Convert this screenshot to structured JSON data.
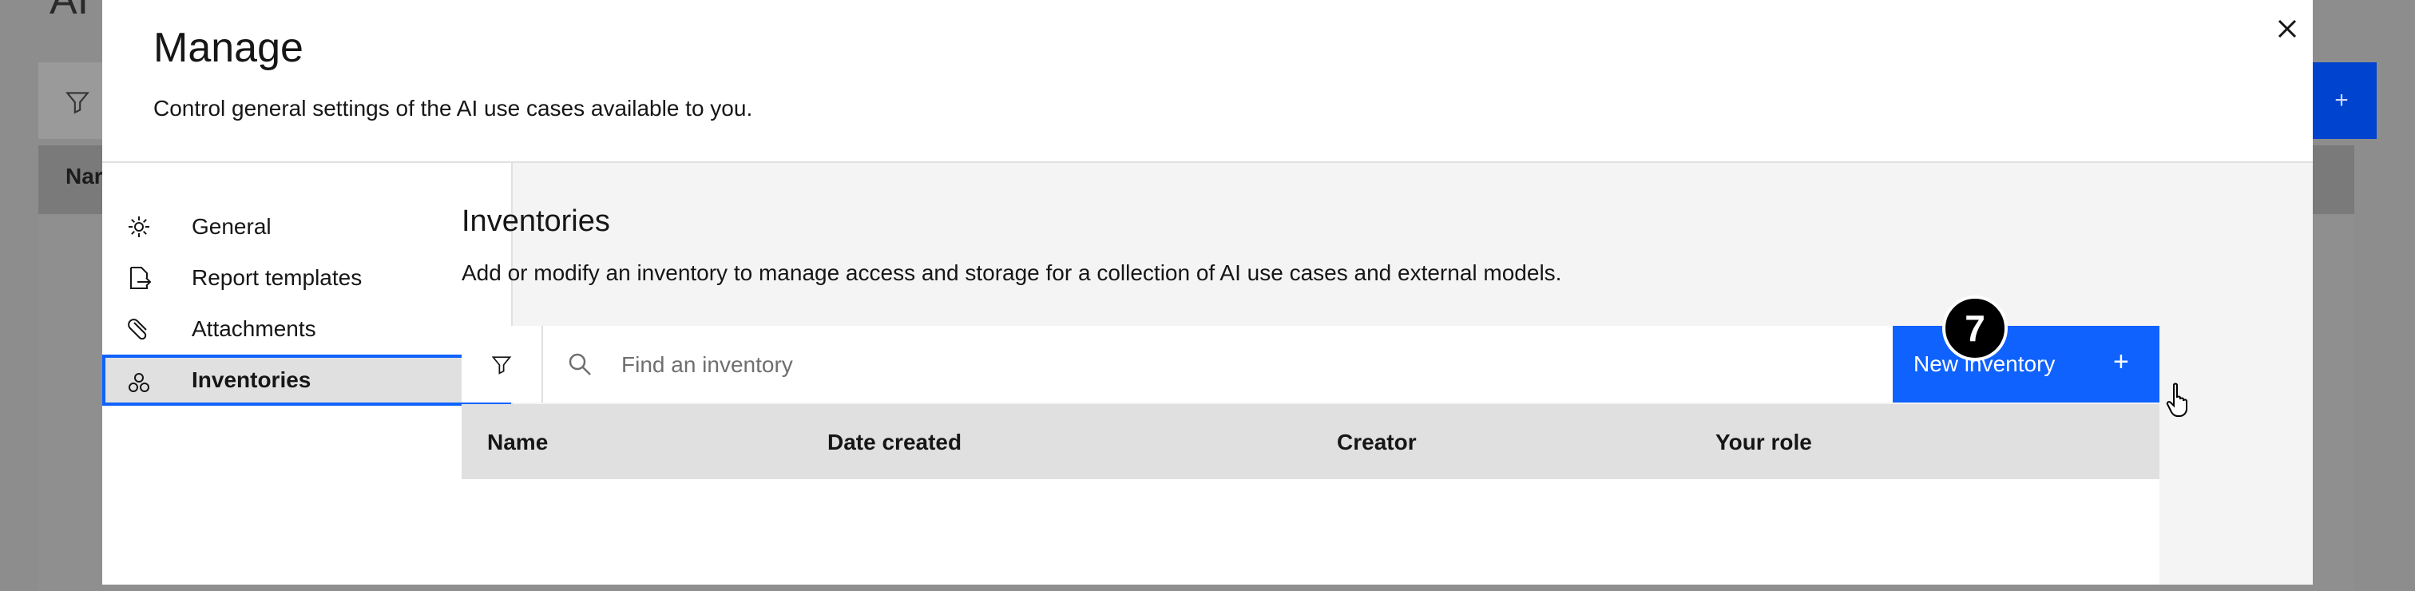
{
  "background": {
    "title_fragment": "AI",
    "header_fragment": "Nar",
    "add_label": "+"
  },
  "modal": {
    "title": "Manage",
    "subtitle": "Control general settings of the AI use cases available to you.",
    "close_icon": "close-icon"
  },
  "nav": {
    "items": [
      {
        "label": "General",
        "icon": "gear-icon"
      },
      {
        "label": "Report templates",
        "icon": "document-export-icon"
      },
      {
        "label": "Attachments",
        "icon": "paperclip-icon"
      },
      {
        "label": "Inventories",
        "icon": "inventory-icon",
        "active": true
      }
    ]
  },
  "content": {
    "title": "Inventories",
    "description": "Add or modify an inventory to manage access and storage for a collection of AI use cases and external models.",
    "search_placeholder": "Find an inventory",
    "new_button_label": "New inventory",
    "new_button_icon": "+",
    "step_badge": "7"
  },
  "table": {
    "columns": [
      "Name",
      "Date created",
      "Creator",
      "Your role"
    ]
  },
  "colors": {
    "primary": "#0f62fe",
    "overlay": "#8d8d8d",
    "active_bg": "#e0e0e0"
  }
}
